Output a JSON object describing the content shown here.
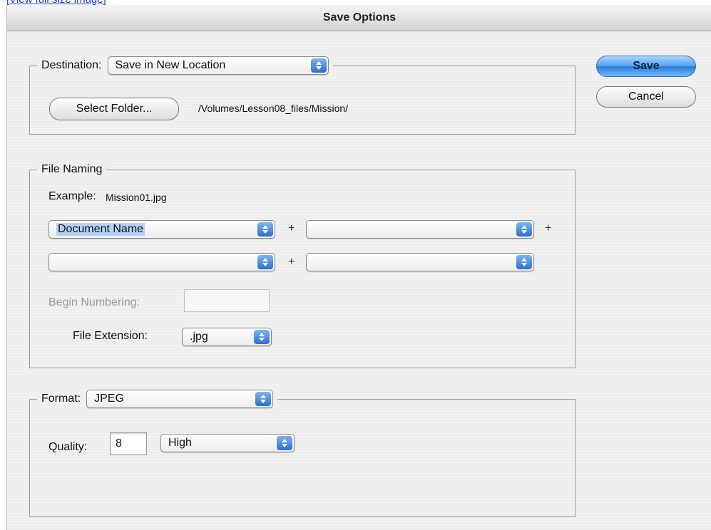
{
  "link": {
    "text": "[View full size image]"
  },
  "dialog": {
    "title": "Save Options"
  },
  "buttons": {
    "save": "Save",
    "cancel": "Cancel"
  },
  "destination": {
    "label": "Destination:",
    "value": "Save in New Location",
    "select_folder": "Select Folder...",
    "path": "/Volumes/Lesson08_files/Mission/"
  },
  "file_naming": {
    "title": "File Naming",
    "example_label": "Example:",
    "example_value": "Mission01.jpg",
    "field1": "Document Name",
    "field2": "",
    "field3": "",
    "field4": "",
    "plus": "+",
    "begin_numbering_label": "Begin Numbering:",
    "begin_numbering_value": "",
    "extension_label": "File Extension:",
    "extension_value": ".jpg"
  },
  "format": {
    "label": "Format:",
    "value": "JPEG",
    "quality_label": "Quality:",
    "quality_value": "8",
    "quality_level": "High"
  },
  "colors": {
    "accent": "#2c6fd0",
    "selection": "#b5d2f6"
  }
}
